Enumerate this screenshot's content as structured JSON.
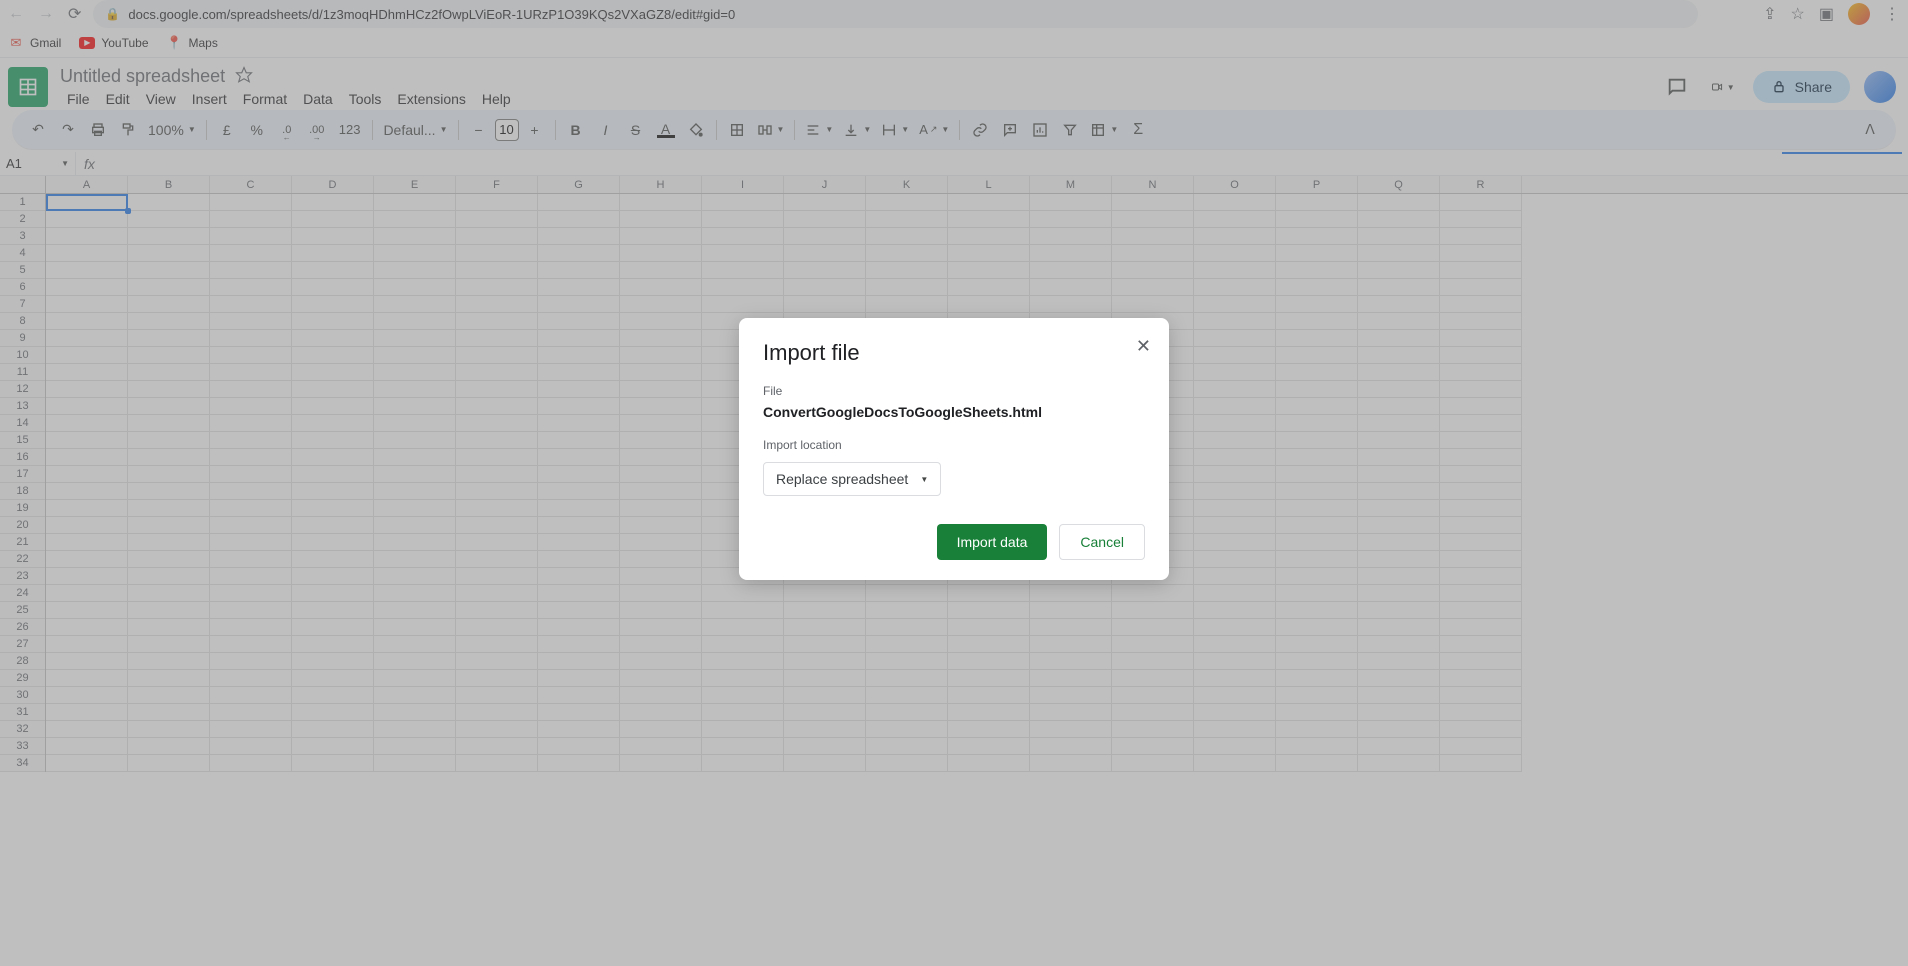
{
  "browser": {
    "url": "docs.google.com/spreadsheets/d/1z3moqHDhmHCz2fOwpLViEoR-1URzP1O39KQs2VXaGZ8/edit#gid=0"
  },
  "bookmarks": {
    "gmail": "Gmail",
    "youtube": "YouTube",
    "maps": "Maps"
  },
  "doc": {
    "title": "Untitled spreadsheet"
  },
  "menubar": {
    "file": "File",
    "edit": "Edit",
    "view": "View",
    "insert": "Insert",
    "format": "Format",
    "data": "Data",
    "tools": "Tools",
    "extensions": "Extensions",
    "help": "Help"
  },
  "toolbar": {
    "zoom": "100%",
    "currency": "£",
    "percent": "%",
    "decimal_dec": ".0",
    "decimal_inc": ".00",
    "numfmt": "123",
    "font": "Defaul...",
    "font_size": "10"
  },
  "header": {
    "share": "Share"
  },
  "namebox": {
    "cell": "A1"
  },
  "columns": [
    "A",
    "B",
    "C",
    "D",
    "E",
    "F",
    "G",
    "H",
    "I",
    "J",
    "K",
    "L",
    "M",
    "N",
    "O",
    "P",
    "Q",
    "R"
  ],
  "rows": [
    "1",
    "2",
    "3",
    "4",
    "5",
    "6",
    "7",
    "8",
    "9",
    "10",
    "11",
    "12",
    "13",
    "14",
    "15",
    "16",
    "17",
    "18",
    "19",
    "20",
    "21",
    "22",
    "23",
    "24",
    "25",
    "26",
    "27",
    "28",
    "29",
    "30",
    "31",
    "32",
    "33",
    "34"
  ],
  "dialog": {
    "title": "Import file",
    "file_label": "File",
    "file_name": "ConvertGoogleDocsToGoogleSheets.html",
    "location_label": "Import location",
    "location_value": "Replace spreadsheet",
    "import_btn": "Import data",
    "cancel_btn": "Cancel"
  }
}
